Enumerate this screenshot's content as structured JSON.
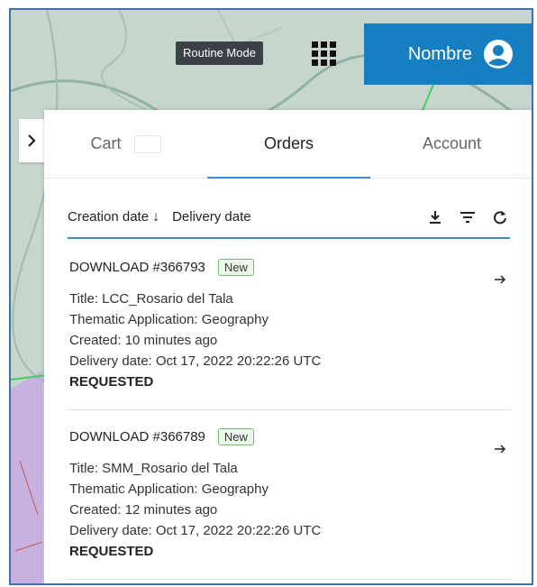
{
  "header": {
    "mode_chip": "Routine Mode",
    "user_name": "Nombre"
  },
  "tabs": [
    "Cart",
    "Orders",
    "Account"
  ],
  "sort": {
    "creation_date": "Creation date",
    "delivery_date": "Delivery date"
  },
  "orders": [
    {
      "id": "DOWNLOAD #366793",
      "badge": "New",
      "title": "Title: LCC_Rosario del Tala",
      "thematic": "Thematic Application: Geography",
      "created": "Created: 10 minutes ago",
      "delivery": "Delivery date: Oct 17, 2022 20:22:26 UTC",
      "status": "REQUESTED"
    },
    {
      "id": "DOWNLOAD #366789",
      "badge": "New",
      "title": "Title: SMM_Rosario del Tala",
      "thematic": "Thematic Application: Geography",
      "created": "Created: 12 minutes ago",
      "delivery": "Delivery date: Oct 17, 2022 20:22:26 UTC",
      "status": "REQUESTED"
    }
  ],
  "colors": {
    "accent": "#3f88c8",
    "user_button": "#167fc1",
    "badge_border": "#6fbf6f"
  }
}
